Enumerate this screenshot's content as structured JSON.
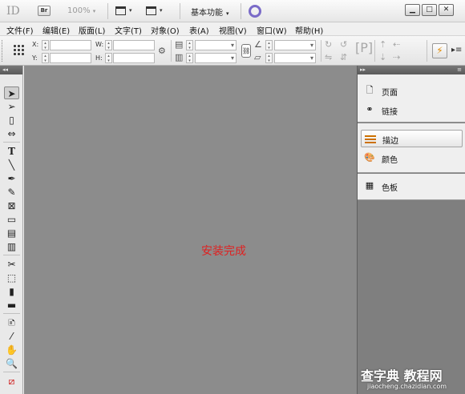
{
  "appbar": {
    "app_logo": "ID",
    "bridge_label": "Br",
    "zoom": "100%",
    "workspace": "基本功能",
    "window_controls": [
      "▁",
      "□",
      "✕"
    ]
  },
  "menu": [
    "文件(F)",
    "编辑(E)",
    "版面(L)",
    "文字(T)",
    "对象(O)",
    "表(A)",
    "视图(V)",
    "窗口(W)",
    "帮助(H)"
  ],
  "control": {
    "x_label": "X:",
    "y_label": "Y:",
    "w_label": "W:",
    "h_label": "H:"
  },
  "tools_panel": {
    "collapse": "◂◂"
  },
  "canvas": {
    "status_text": "安装完成"
  },
  "panels": {
    "collapse": "▸▸",
    "menu": "≡",
    "groups": [
      {
        "items": [
          {
            "label": "页面",
            "icon": "pages-icon"
          },
          {
            "label": "链接",
            "icon": "links-icon"
          }
        ]
      },
      {
        "items": [
          {
            "label": "描边",
            "icon": "stroke-icon",
            "selected": true
          },
          {
            "label": "颜色",
            "icon": "color-icon"
          }
        ]
      },
      {
        "items": [
          {
            "label": "色板",
            "icon": "swatches-icon"
          }
        ]
      }
    ]
  },
  "watermark": {
    "main": "查字典 教程网",
    "sub": "jiaocheng.chazidian.com"
  }
}
